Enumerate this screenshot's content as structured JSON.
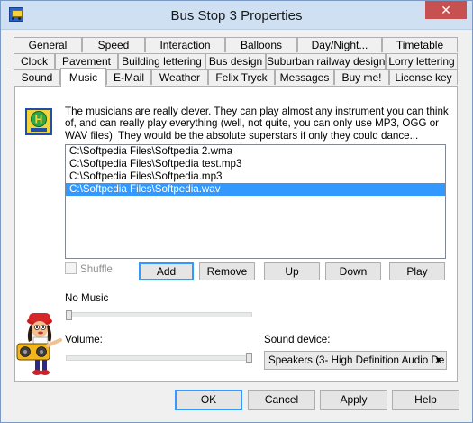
{
  "window": {
    "title": "Bus Stop 3 Properties",
    "close_symbol": "✕"
  },
  "tabs_row1": [
    "General",
    "Speed",
    "Interaction",
    "Balloons",
    "Day/Night...",
    "Timetable"
  ],
  "tabs_row2": [
    "Clock",
    "Pavement",
    "Building lettering",
    "Bus design",
    "Suburban railway design",
    "Lorry lettering"
  ],
  "tabs_row3": [
    "Sound",
    "Music",
    "E-Mail",
    "Weather",
    "Felix Tryck",
    "Messages",
    "Buy me!",
    "License key"
  ],
  "music": {
    "description": "The musicians are really clever. They can play almost any instrument you can think of, and can really play everything (well, not quite, you can only use MP3, OGG or WAV files). They would be the absolute superstars if only they could dance...",
    "files": [
      "C:\\Softpedia Files\\Softpedia 2.wma",
      "C:\\Softpedia Files\\Softpedia test.mp3",
      "C:\\Softpedia Files\\Softpedia.mp3",
      "C:\\Softpedia Files\\Softpedia.wav"
    ],
    "selected_index": 3,
    "shuffle_label": "Shuffle",
    "buttons": {
      "add": "Add",
      "remove": "Remove",
      "up": "Up",
      "down": "Down",
      "play": "Play"
    },
    "no_music_label": "No Music",
    "volume_label": "Volume:",
    "volume_level": 1.0,
    "no_music_level": 0.0,
    "sound_device_label": "Sound device:",
    "sound_device_value": "Speakers (3- High Definition Audio De"
  },
  "footer": {
    "ok": "OK",
    "cancel": "Cancel",
    "apply": "Apply",
    "help": "Help"
  },
  "icons": {
    "close": "close-icon",
    "app": "bus-stop-icon",
    "sign": "bus-stop-sign-icon",
    "mascot": "musician-mascot-icon",
    "dropdown": "chevron-down-icon"
  }
}
